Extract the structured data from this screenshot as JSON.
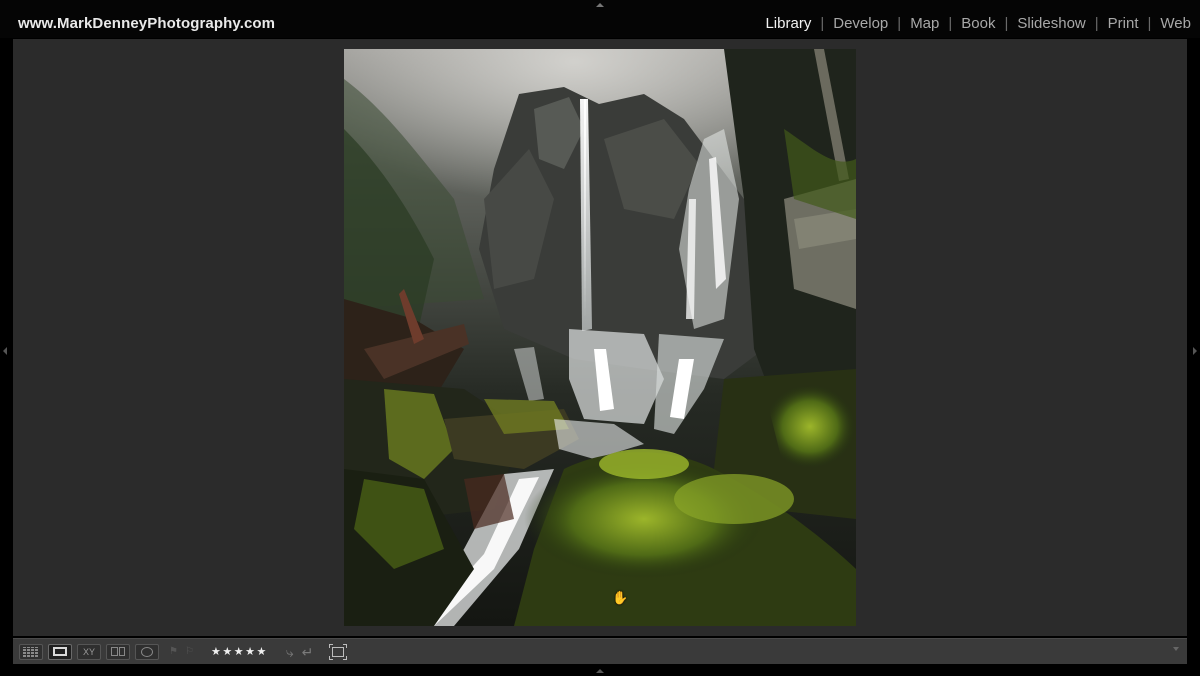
{
  "header": {
    "brand": "www.MarkDenneyPhotography.com",
    "modules": [
      {
        "label": "Library",
        "active": true
      },
      {
        "label": "Develop",
        "active": false
      },
      {
        "label": "Map",
        "active": false
      },
      {
        "label": "Book",
        "active": false
      },
      {
        "label": "Slideshow",
        "active": false
      },
      {
        "label": "Print",
        "active": false
      },
      {
        "label": "Web",
        "active": false
      }
    ],
    "separator": "|"
  },
  "photo": {
    "subject": "misty waterfall over mossy rocks",
    "icon": "hand-cursor-icon"
  },
  "toolbar": {
    "view_buttons": [
      {
        "name": "grid-view-button",
        "icon": "grid-icon",
        "selected": false
      },
      {
        "name": "loupe-view-button",
        "icon": "loupe-icon",
        "selected": true
      },
      {
        "name": "compare-view-button",
        "label": "XY",
        "selected": false
      },
      {
        "name": "survey-view-button",
        "icon": "survey-icon",
        "selected": false
      },
      {
        "name": "people-view-button",
        "icon": "people-icon",
        "selected": false
      }
    ],
    "flags": [
      "flag-pick-icon",
      "flag-reject-icon"
    ],
    "rating": 5,
    "stars": "★★★★★",
    "rotate_left": "⤷",
    "rotate_right": "↵",
    "crop_icon": "crop-overlay-icon"
  },
  "colors": {
    "background": "#000000",
    "panel": "#2b2b2b",
    "toolbar": "#3a3a3a",
    "active_module": "#f2f2f2",
    "inactive_module": "#a8a8a8"
  }
}
